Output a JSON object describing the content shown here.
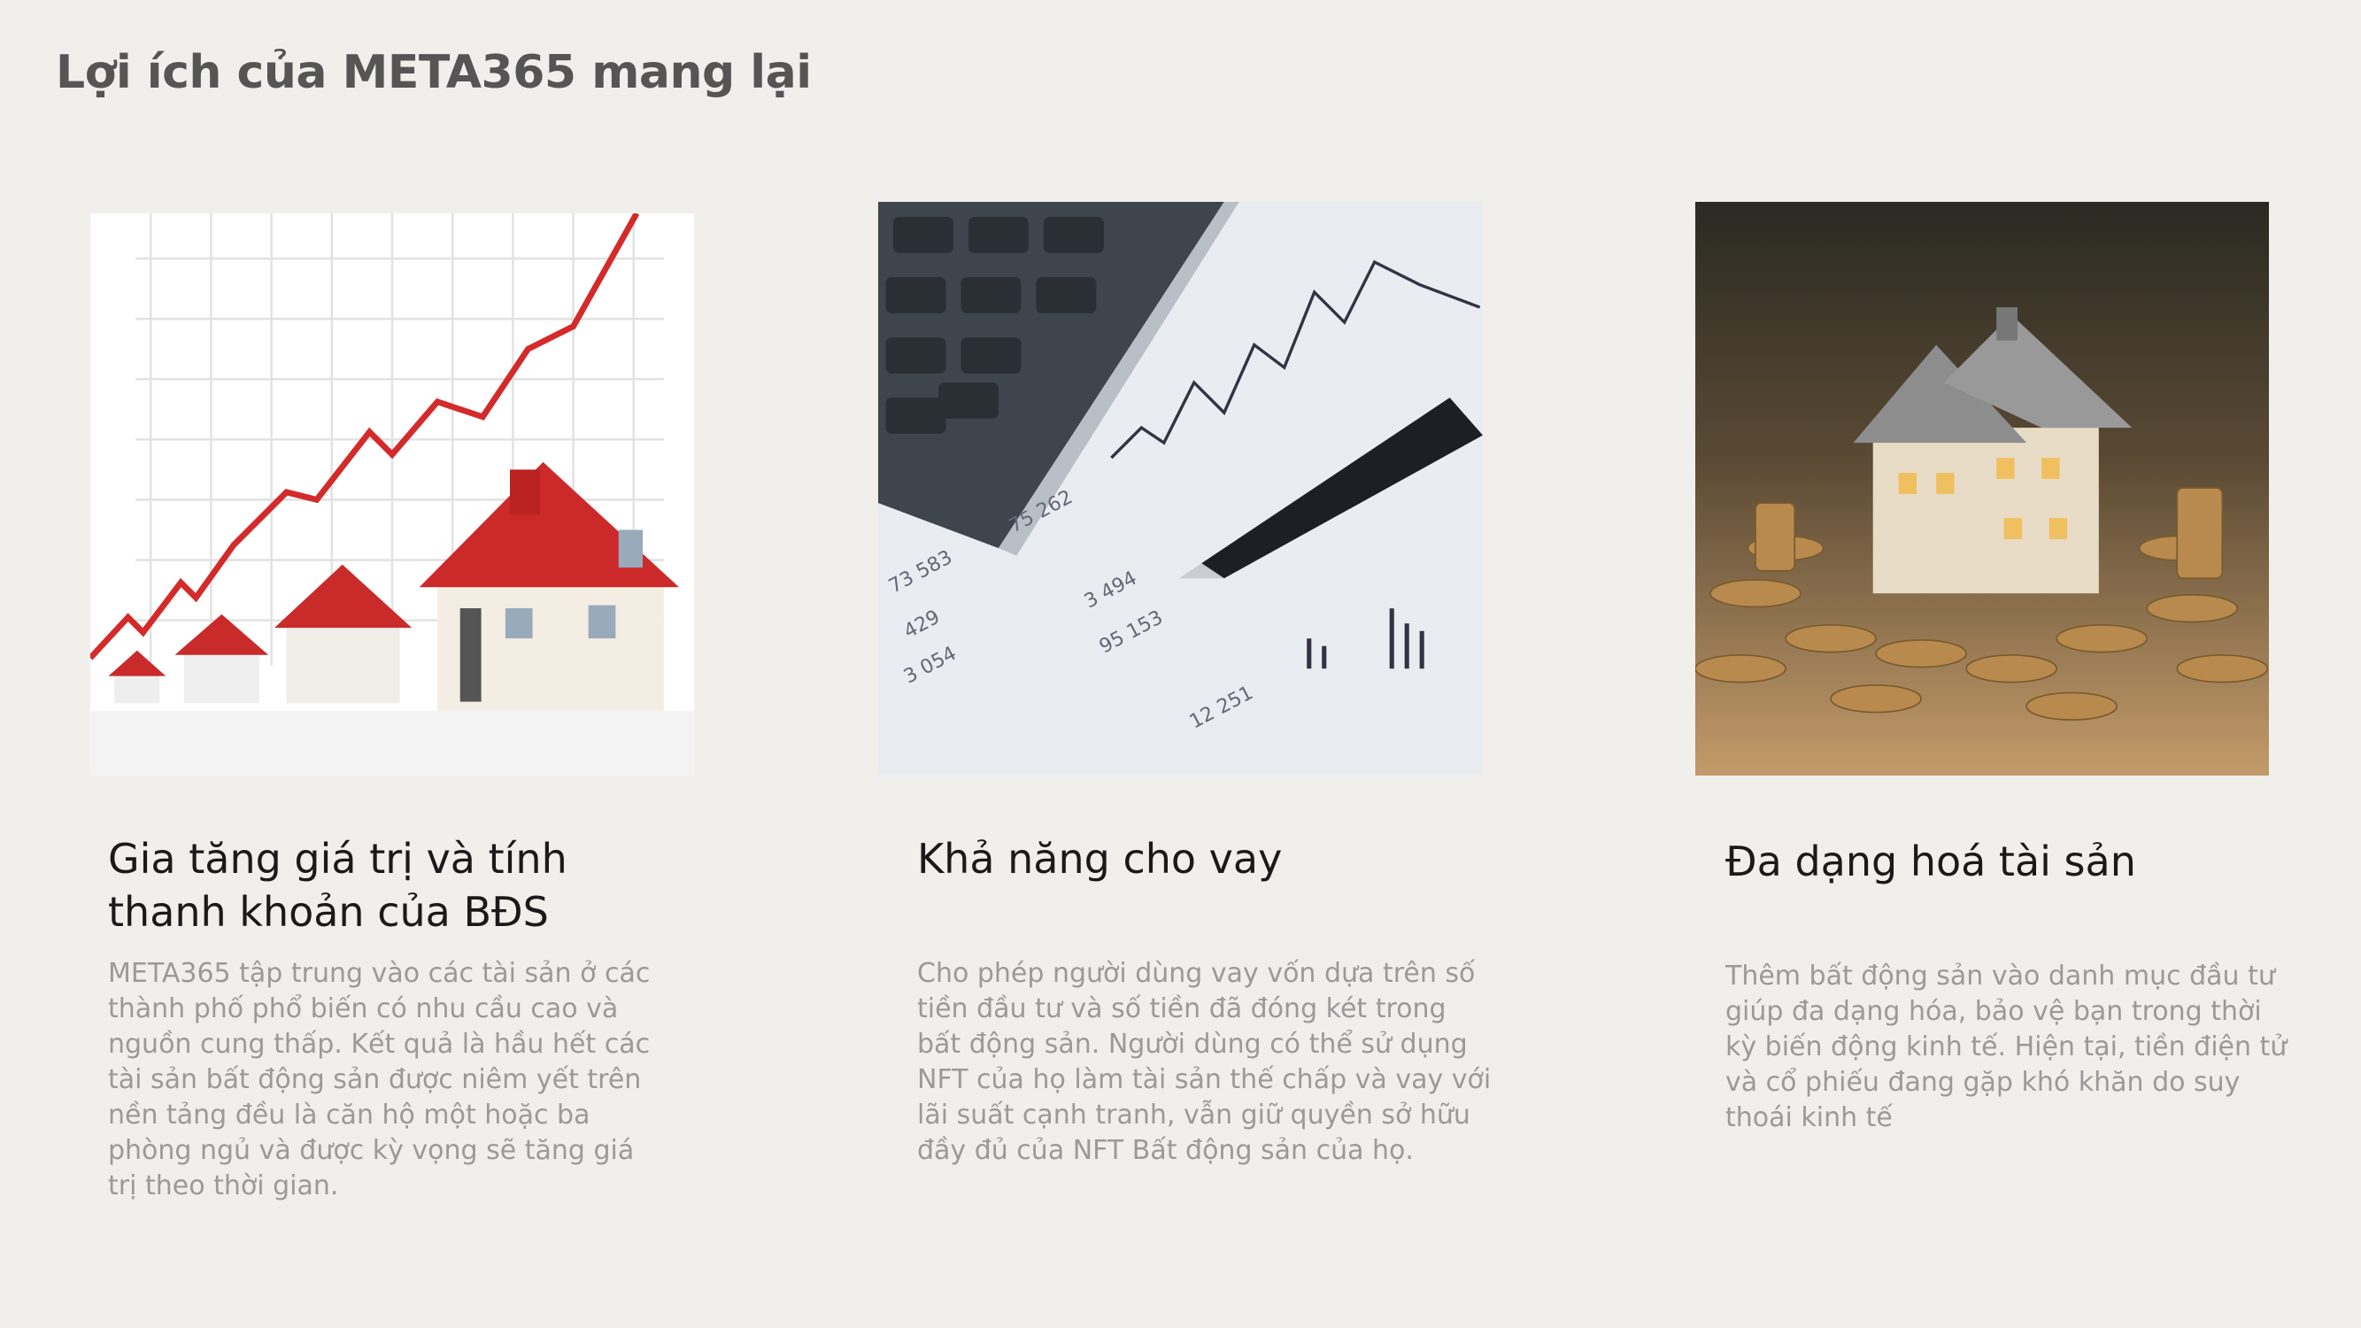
{
  "page": {
    "title": "Lợi ích của META365 mang lại"
  },
  "cards": [
    {
      "image": "rising-chart-houses-image",
      "heading": "Gia tăng giá trị và tính thanh khoản của BĐS",
      "body": "META365 tập trung vào các tài sản ở các thành phố phổ biến có nhu cầu cao và nguồn cung thấp. Kết quả là hầu hết các tài sản bất động sản được niêm yết trên nền tảng đều là căn hộ một hoặc ba phòng ngủ và được kỳ vọng sẽ tăng giá trị theo thời gian."
    },
    {
      "image": "calculator-pen-financial-report-image",
      "heading": "Khả năng cho vay",
      "body": "Cho phép người dùng vay vốn dựa trên số tiền đầu tư và số tiền đã đóng két trong bất động sản. Người dùng có thể sử dụng NFT của họ làm tài sản thế chấp và vay với lãi suất cạnh tranh, vẫn giữ quyền sở hữu đầy đủ của NFT Bất động sản của họ."
    },
    {
      "image": "house-on-coins-image",
      "heading": "Đa dạng hoá tài sản",
      "body": "Thêm bất động sản vào danh mục đầu tư giúp đa dạng hóa, bảo vệ bạn trong thời kỳ biến động kinh tế. Hiện tại, tiền điện tử và cổ phiếu đang gặp khó khăn do suy thoái kinh tế"
    }
  ],
  "colors": {
    "background": "#f1efeb",
    "title": "#555555",
    "heading": "#1a1a1a",
    "body": "#9a9a9a",
    "accent_red": "#d42a2a"
  }
}
